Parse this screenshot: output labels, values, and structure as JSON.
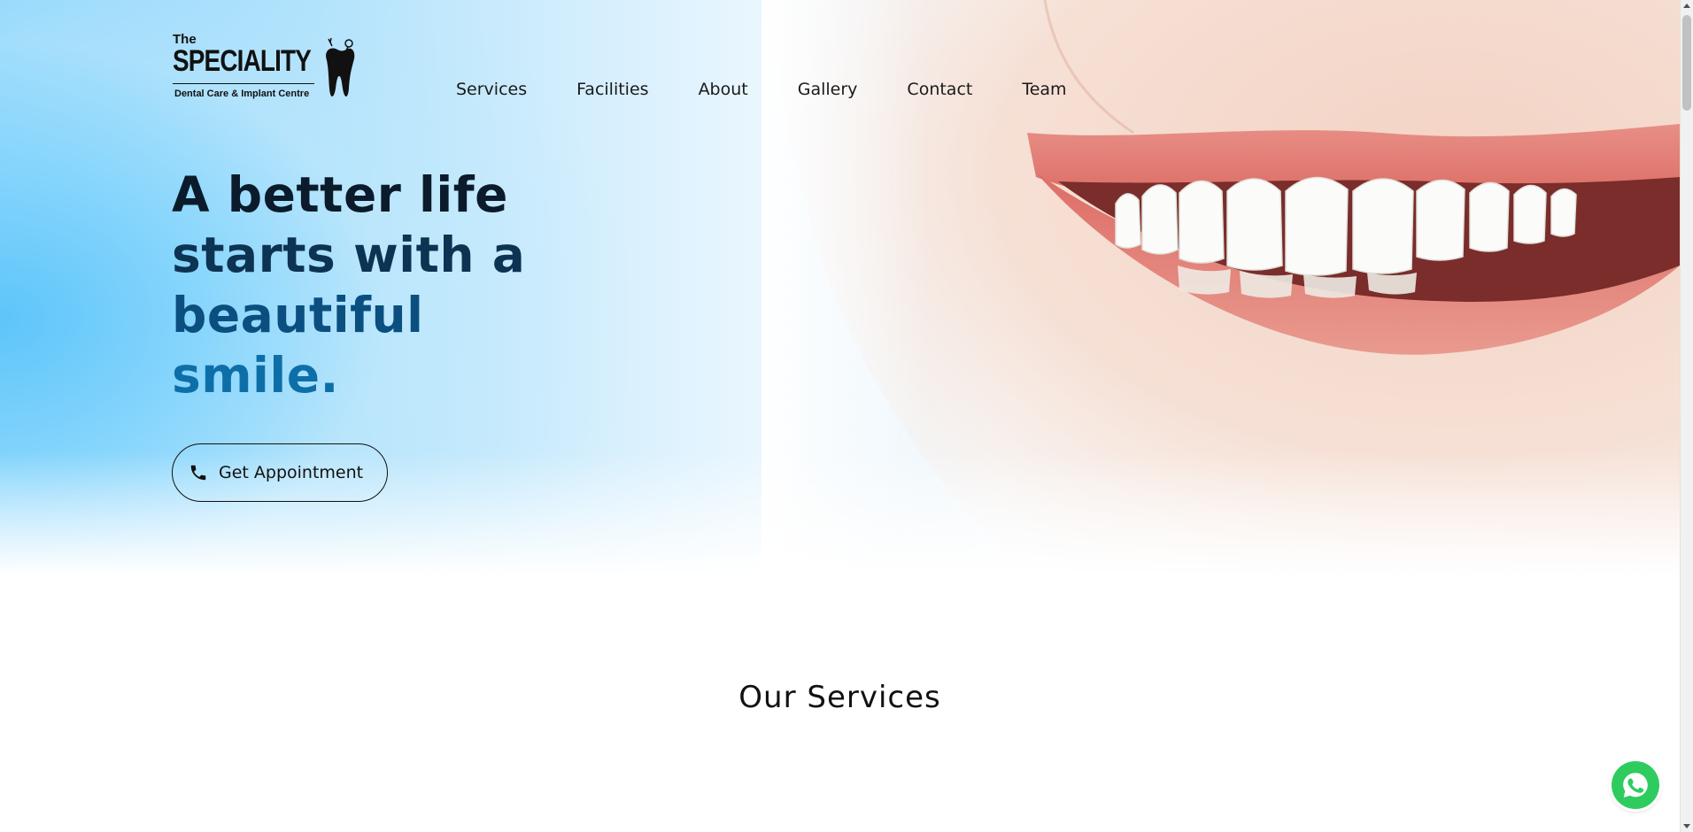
{
  "logo": {
    "the": "The",
    "name": "SPECIALITY",
    "tagline": "Dental Care & Implant Centre",
    "icon": "tooth-icon"
  },
  "nav": {
    "items": [
      {
        "label": "Services"
      },
      {
        "label": "Facilities"
      },
      {
        "label": "About"
      },
      {
        "label": "Gallery"
      },
      {
        "label": "Contact"
      },
      {
        "label": "Team"
      }
    ]
  },
  "hero": {
    "headline_lines": [
      "A better life",
      "starts with a",
      "beautiful",
      "smile."
    ],
    "cta": {
      "label": "Get Appointment",
      "icon": "phone-icon"
    }
  },
  "services": {
    "title": "Our Services"
  },
  "whatsapp": {
    "icon": "whatsapp-icon"
  },
  "colors": {
    "hero_sky_blue": "#5ec5fa",
    "headline_dark": "#0b1b2b",
    "headline_blue": "#0e6fa8",
    "whatsapp_green": "#2ecc5f"
  }
}
